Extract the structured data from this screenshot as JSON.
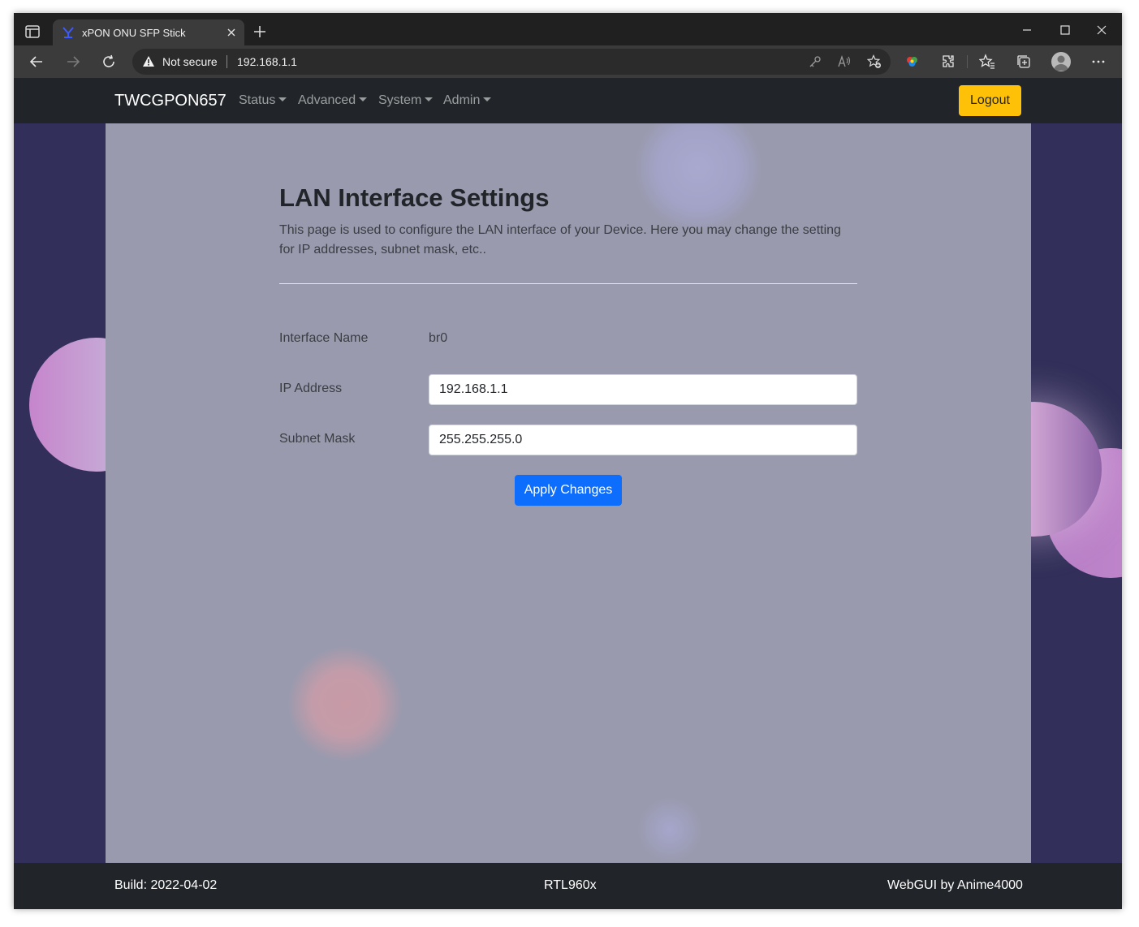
{
  "browser": {
    "tab_title": "xPON ONU SFP Stick",
    "security_label": "Not secure",
    "url": "192.168.1.1"
  },
  "navbar": {
    "brand": "TWCGPON657",
    "menus": [
      "Status",
      "Advanced",
      "System",
      "Admin"
    ],
    "logout_label": "Logout",
    "logout_color": "#ffc107"
  },
  "main": {
    "title": "LAN Interface Settings",
    "description": "This page is used to configure the LAN interface of your Device. Here you may change the setting for IP addresses, subnet mask, etc..",
    "fields": {
      "interface_name": {
        "label": "Interface Name",
        "value": "br0"
      },
      "ip_address": {
        "label": "IP Address",
        "value": "192.168.1.1"
      },
      "subnet_mask": {
        "label": "Subnet Mask",
        "value": "255.255.255.0"
      }
    },
    "apply_label": "Apply Changes",
    "apply_color": "#0d6efd"
  },
  "footer": {
    "build": "Build: 2022-04-02",
    "chip": "RTL960x",
    "credit": "WebGUI by Anime4000"
  }
}
